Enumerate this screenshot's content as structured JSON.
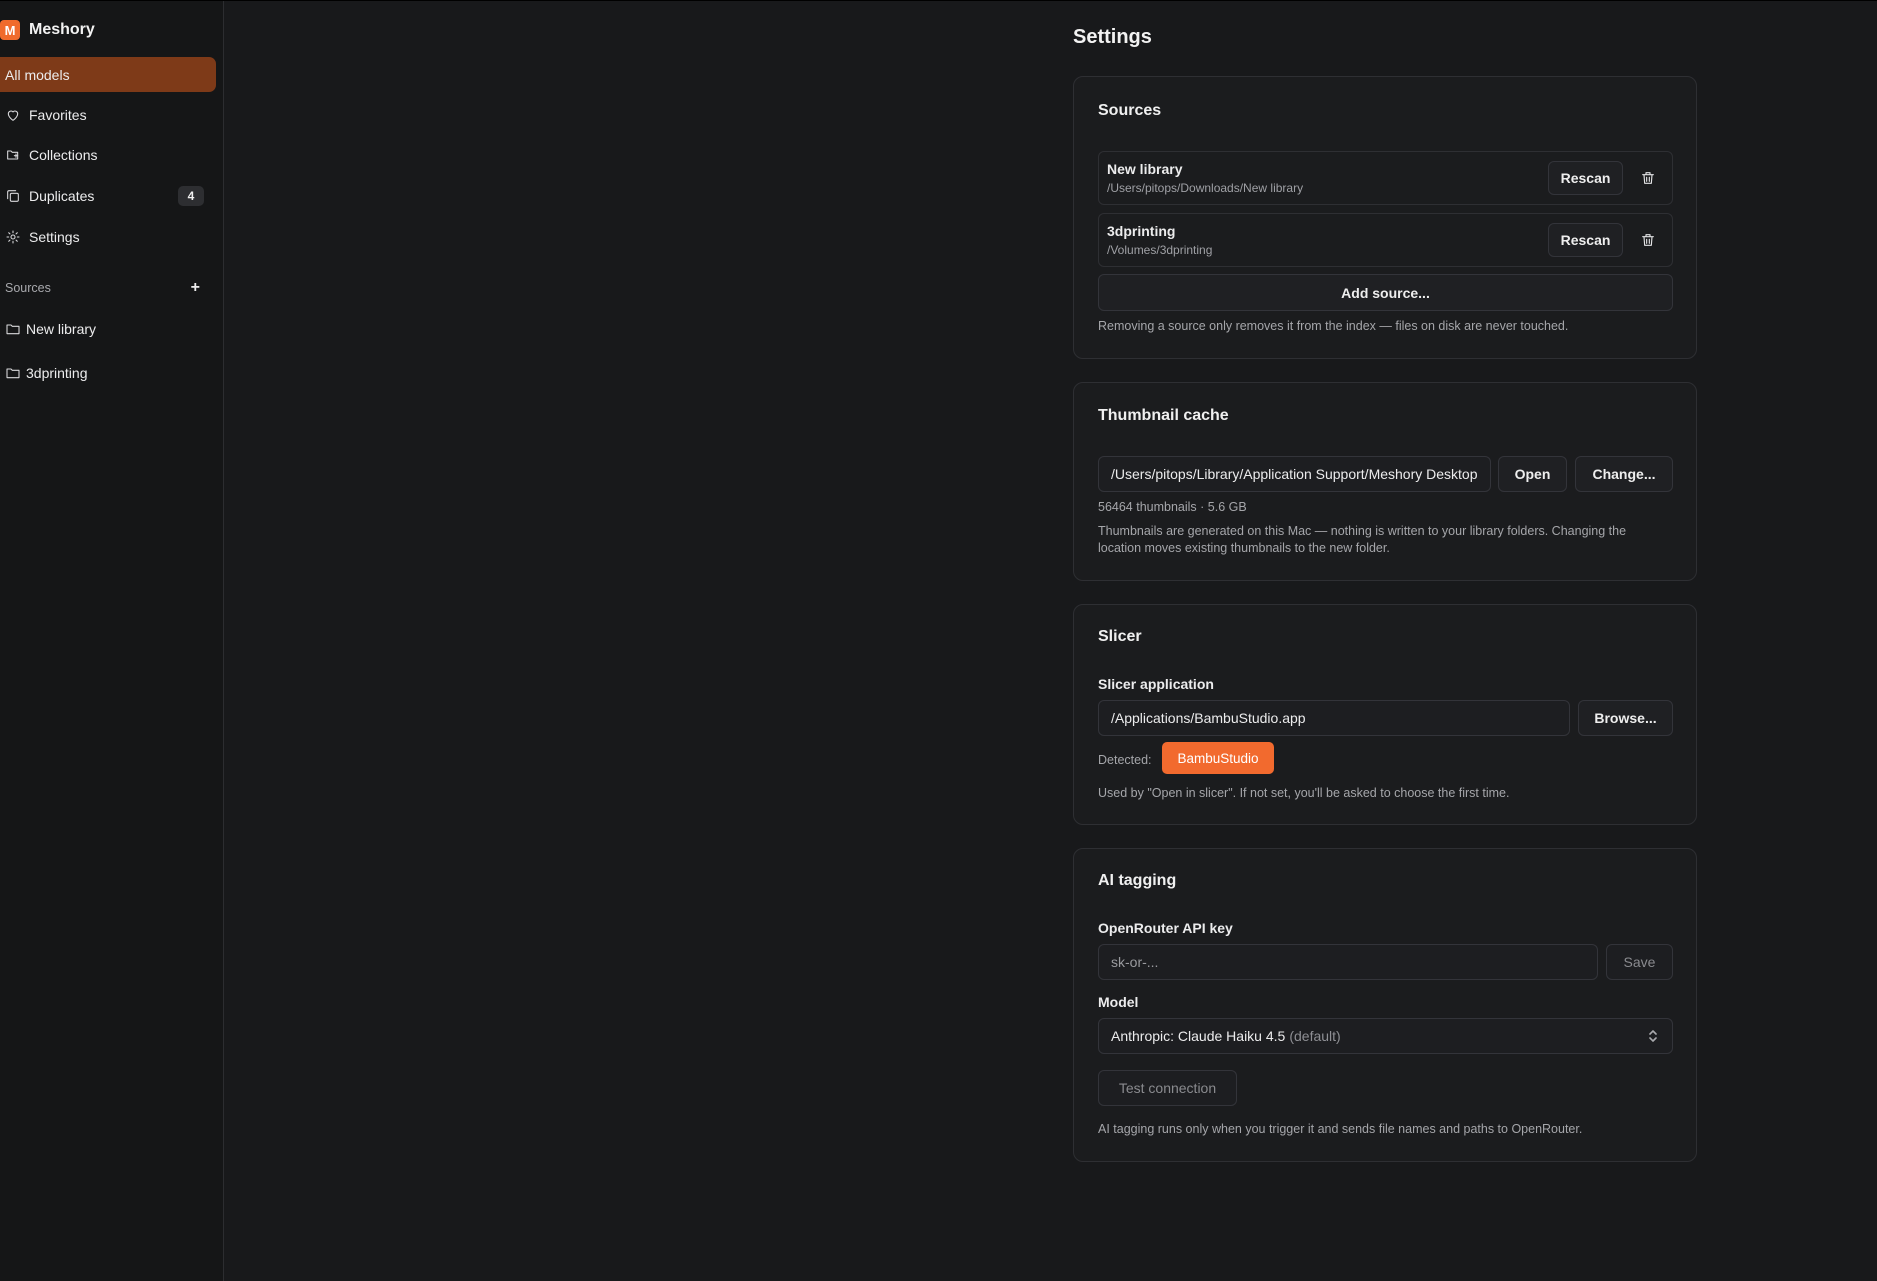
{
  "app": {
    "logo_letter": "M",
    "name": "Meshory"
  },
  "sidebar": {
    "nav": [
      {
        "label": "All models",
        "icon": "none",
        "active": true
      },
      {
        "label": "Favorites",
        "icon": "heart-icon"
      },
      {
        "label": "Collections",
        "icon": "folder-stack-icon"
      },
      {
        "label": "Duplicates",
        "icon": "copy-icon",
        "badge": "4"
      },
      {
        "label": "Settings",
        "icon": "gear-icon"
      }
    ],
    "sources_heading": "Sources",
    "add_symbol": "+",
    "sources": [
      {
        "label": "New library",
        "icon": "folder-icon"
      },
      {
        "label": "3dprinting",
        "icon": "folder-icon"
      }
    ]
  },
  "page": {
    "title": "Settings"
  },
  "sources_card": {
    "title": "Sources",
    "rows": [
      {
        "name": "New library",
        "path": "/Users/pitops/Downloads/New library",
        "rescan_label": "Rescan"
      },
      {
        "name": "3dprinting",
        "path": "/Volumes/3dprinting",
        "rescan_label": "Rescan"
      }
    ],
    "add_label": "Add source...",
    "note": "Removing a source only removes it from the index — files on disk are never touched."
  },
  "thumb_card": {
    "title": "Thumbnail cache",
    "path_value": "/Users/pitops/Library/Application Support/Meshory Desktop",
    "open_label": "Open",
    "change_label": "Change...",
    "stats": "56464 thumbnails · 5.6 GB",
    "note": "Thumbnails are generated on this Mac — nothing is written to your library folders. Changing the location moves existing thumbnails to the new folder."
  },
  "slicer_card": {
    "title": "Slicer",
    "field_label": "Slicer application",
    "path_value": "/Applications/BambuStudio.app",
    "browse_label": "Browse...",
    "detected_label": "Detected:",
    "detected_value": "BambuStudio",
    "note": "Used by \"Open in slicer\". If not set, you'll be asked to choose the first time."
  },
  "ai_card": {
    "title": "AI tagging",
    "key_label": "OpenRouter API key",
    "key_placeholder": "sk-or-...",
    "save_label": "Save",
    "model_label": "Model",
    "model_value": "Anthropic: Claude Haiku 4.5",
    "model_suffix": "(default)",
    "test_label": "Test connection",
    "note": "AI tagging runs only when you trigger it and sends file names and paths to OpenRouter."
  },
  "colors": {
    "accent": "#f26a2e",
    "active_nav": "#7e3a18",
    "background": "#18191b"
  }
}
